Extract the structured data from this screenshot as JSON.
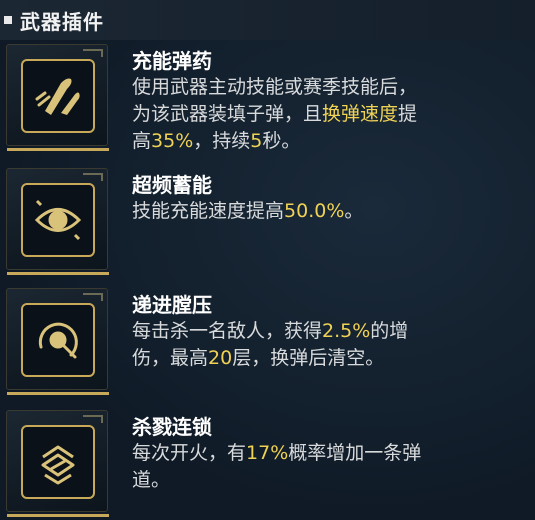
{
  "header": {
    "title": "武器插件"
  },
  "plugins": [
    {
      "name": "充能弹药",
      "icon": "ammo-rounds-icon",
      "lines": [
        [
          "使用武器主动技能或赛季技能后，"
        ],
        [
          "为该武器装填子弹，且",
          "换弹速度",
          "提"
        ],
        [
          "高",
          "35%",
          "，持续",
          "5",
          "秒。"
        ]
      ]
    },
    {
      "name": "超频蓄能",
      "icon": "eye-target-icon",
      "lines": [
        [
          "技能充能速度提高",
          "50.0%",
          "。"
        ]
      ]
    },
    {
      "name": "递进膛压",
      "icon": "pressure-gauge-icon",
      "lines": [
        [
          "每击杀一名敌人，获得",
          "2.5%",
          "的增"
        ],
        [
          "伤，最高",
          "20",
          "层，换弹后清空。"
        ]
      ]
    },
    {
      "name": "杀戮连锁",
      "icon": "chain-link-icon",
      "lines": [
        [
          "每次开火，有",
          "17%",
          "概率增加一条弹"
        ],
        [
          "道。"
        ]
      ]
    }
  ],
  "colors": {
    "highlight": "#f0d255",
    "gold_border": "#c8a95a"
  }
}
